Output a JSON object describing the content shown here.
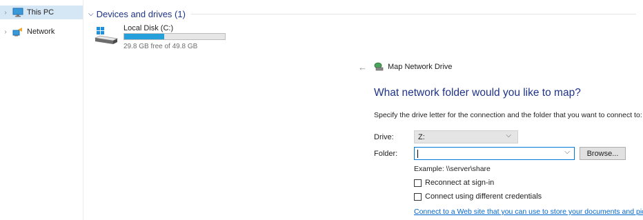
{
  "nav": {
    "items": [
      {
        "label": "This PC",
        "icon": "monitor-icon",
        "selected": true
      },
      {
        "label": "Network",
        "icon": "network-icon",
        "selected": false
      }
    ]
  },
  "devices": {
    "group_title": "Devices and drives (1)",
    "drive": {
      "name": "Local Disk (C:)",
      "free_text": "29.8 GB free of 49.8 GB",
      "used_fraction": 0.4,
      "bar_color": "#26a0da"
    }
  },
  "wizard": {
    "title": "Map Network Drive",
    "heading": "What network folder would you like to map?",
    "instructions": "Specify the drive letter for the connection and the folder that you want to connect to:",
    "drive_label": "Drive:",
    "drive_value": "Z:",
    "folder_label": "Folder:",
    "folder_value": "",
    "browse_label": "Browse...",
    "example": "Example: \\\\server\\share",
    "reconnect_label": "Reconnect at sign-in",
    "reconnect_checked": false,
    "credentials_label": "Connect using different credentials",
    "credentials_checked": false,
    "web_link": "Connect to a Web site that you can use to store your documents and pictures."
  },
  "colors": {
    "accent_blue": "#1e3287",
    "link_blue": "#0066cc",
    "selected_bg": "#d5e6f5",
    "focus_border": "#0078d7"
  }
}
